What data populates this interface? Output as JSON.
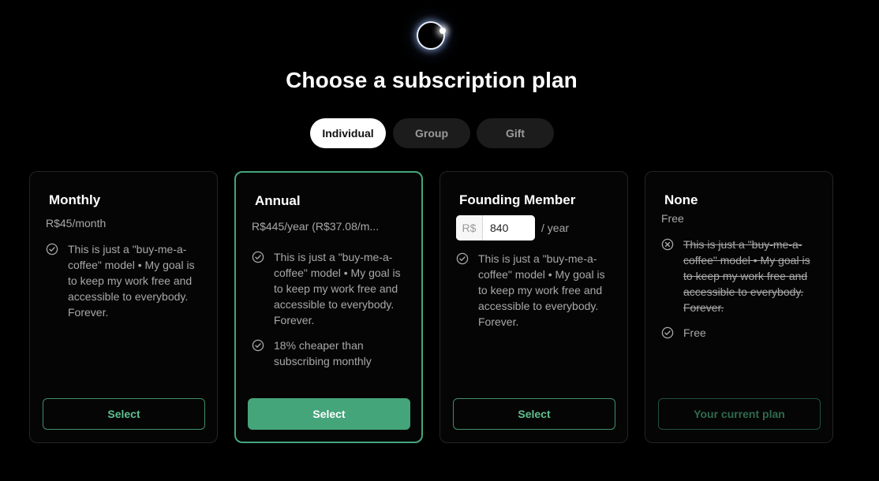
{
  "header": {
    "logo": "eclipse-logo",
    "title": "Choose a subscription plan"
  },
  "tabs": [
    {
      "label": "Individual",
      "active": true
    },
    {
      "label": "Group",
      "active": false
    },
    {
      "label": "Gift",
      "active": false
    }
  ],
  "colors": {
    "accent": "#45a57a",
    "background": "#000000",
    "card_border": "#242424"
  },
  "plans": {
    "monthly": {
      "name": "Monthly",
      "price": "R$45/month",
      "features": [
        "This is just a \"buy-me-a-coffee\" model • My goal is to keep my work free and accessible to everybody. Forever."
      ],
      "button": "Select"
    },
    "annual": {
      "name": "Annual",
      "price": "R$445/year (R$37.08/m...",
      "features": [
        "This is just a \"buy-me-a-coffee\" model • My goal is to keep my work free and accessible to everybody. Forever.",
        "18% cheaper than subscribing monthly"
      ],
      "button": "Select"
    },
    "founding": {
      "name": "Founding Member",
      "currency": "R$",
      "amount": "840",
      "period": "/ year",
      "features": [
        "This is just a \"buy-me-a-coffee\" model • My goal is to keep my work free and accessible to everybody. Forever."
      ],
      "button": "Select"
    },
    "none": {
      "name": "None",
      "price": "Free",
      "features": [
        "This is just a \"buy-me-a-coffee\" model • My goal is to keep my work free and accessible to everybody. Forever.",
        "Free"
      ],
      "button": "Your current plan"
    }
  },
  "icons": {
    "check": "check-circle-icon",
    "excluded": "x-circle-icon"
  }
}
